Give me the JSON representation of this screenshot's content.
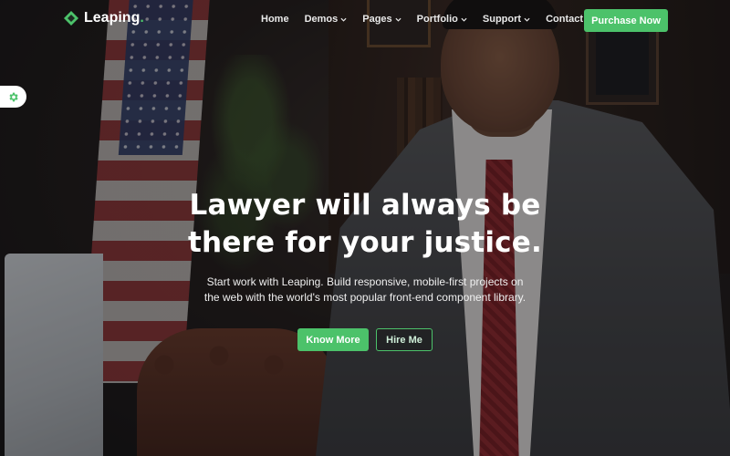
{
  "brand": {
    "name": "Leaping",
    "accent": "#4cc26a",
    "icon": "leaping-logo-icon"
  },
  "nav": {
    "items": [
      {
        "label": "Home",
        "has_dropdown": false
      },
      {
        "label": "Demos",
        "has_dropdown": true
      },
      {
        "label": "Pages",
        "has_dropdown": true
      },
      {
        "label": "Portfolio",
        "has_dropdown": true
      },
      {
        "label": "Support",
        "has_dropdown": true
      },
      {
        "label": "Contact",
        "has_dropdown": false
      }
    ],
    "cta_label": "Purchase Now"
  },
  "settings_tab": {
    "icon": "gear-icon"
  },
  "hero": {
    "title_line1": "Lawyer will always be",
    "title_line2": "there for your justice.",
    "subtitle": "Start work with Leaping. Build responsive, mobile-first projects on the web with the world's most popular front-end component library.",
    "primary_label": "Know More",
    "secondary_label": "Hire Me"
  }
}
